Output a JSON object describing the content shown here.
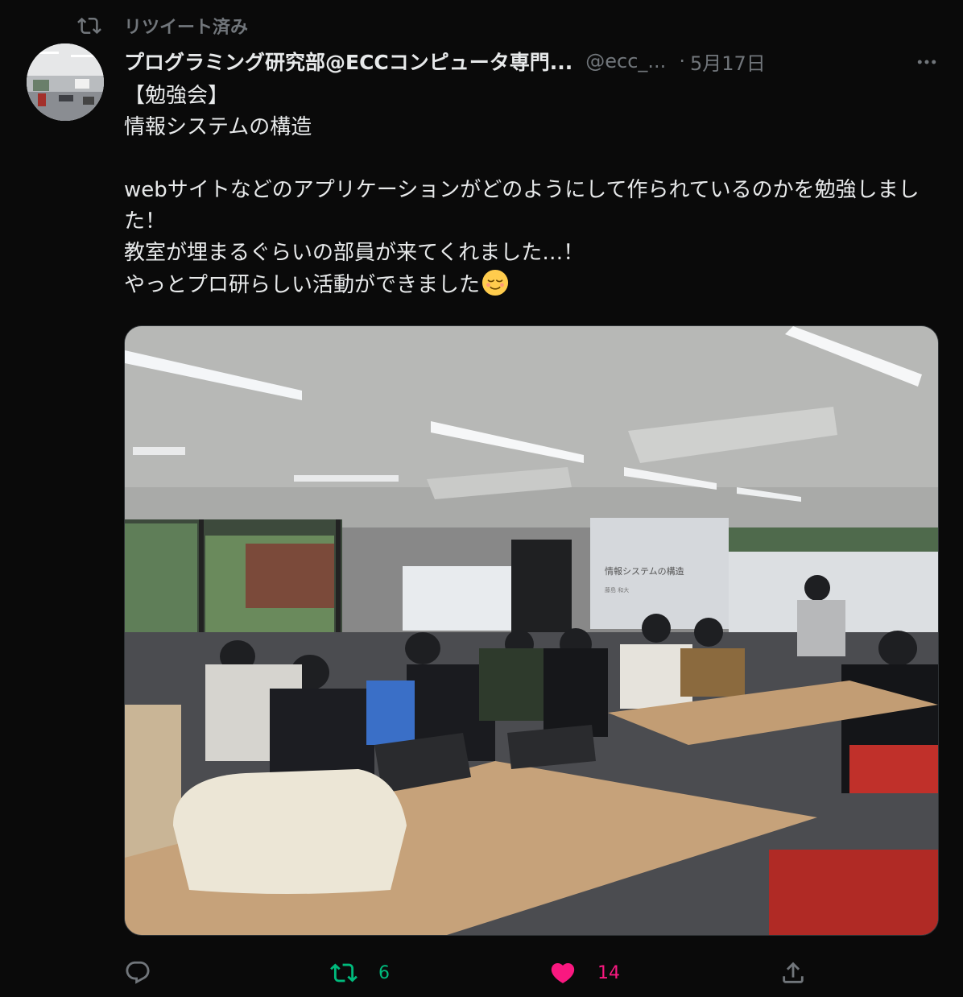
{
  "retweet_header": {
    "label": "リツイート済み",
    "icon": "retweet-icon"
  },
  "author": {
    "display_name": "プログラミング研究部@ECCコンピュータ専門...",
    "handle": "@ecc_...",
    "separator": "·",
    "date": "5月17日",
    "avatar": "classroom-avatar"
  },
  "tweet": {
    "line1": "【勉強会】",
    "line2": "情報システムの構造",
    "line3": "webサイトなどのアプリケーションがどのようにして作られているのかを勉強しました！",
    "line4": "教室が埋まるぐらいの部員が来てくれました…！",
    "line5": "やっとプロ研らしい活動ができました",
    "emoji": "relieved-face-emoji"
  },
  "media": {
    "slide_title": "情報システムの構造",
    "slide_subtitle": "藤島 和大"
  },
  "actions": {
    "reply_count": "",
    "retweet_count": "6",
    "like_count": "14",
    "colors": {
      "retweet": "#00ba7c",
      "like": "#f91880",
      "muted": "#71767b"
    }
  }
}
